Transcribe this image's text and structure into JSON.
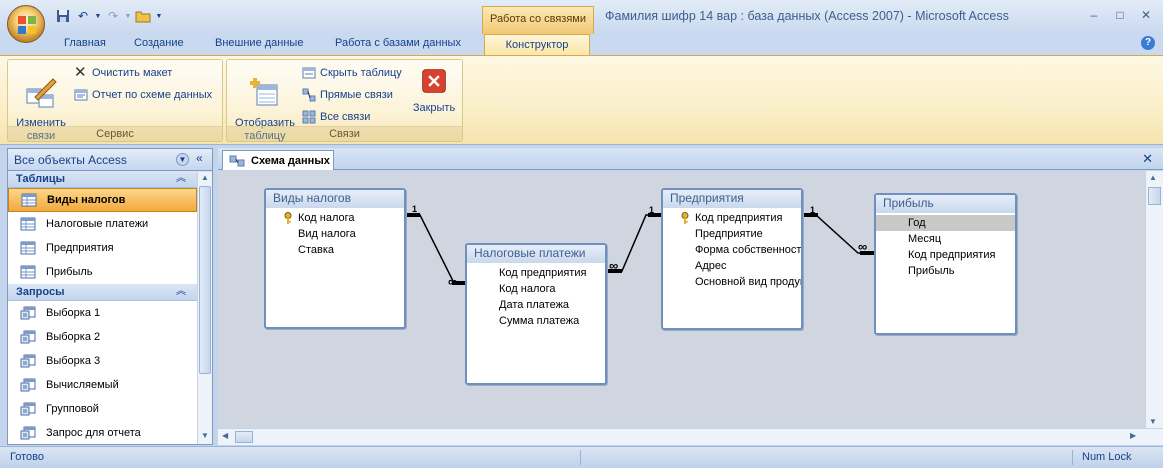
{
  "window": {
    "title": "Фамилия шифр 14 вар : база данных (Access 2007) - Microsoft Access",
    "context_tab_group": "Работа со связями",
    "controls": {
      "minimize": "–",
      "maximize": "□",
      "close": "✕"
    }
  },
  "ribbon_tabs": [
    "Главная",
    "Создание",
    "Внешние данные",
    "Работа с базами данных",
    "Конструктор"
  ],
  "active_tab": "Конструктор",
  "ribbon": {
    "service": {
      "label": "Сервис",
      "edit_relations": "Изменить\nсвязи",
      "clear_layout": "Очистить макет",
      "report": "Отчет по схеме данных"
    },
    "relations": {
      "label": "Связи",
      "show_table": "Отобразить\nтаблицу",
      "hide_table": "Скрыть таблицу",
      "direct_relations": "Прямые связи",
      "all_relations": "Все связи",
      "close": "Закрыть"
    }
  },
  "nav": {
    "title": "Все объекты Access",
    "sections": [
      {
        "label": "Таблицы",
        "items": [
          "Виды налогов",
          "Налоговые платежи",
          "Предприятия",
          "Прибыль"
        ],
        "selected": "Виды налогов"
      },
      {
        "label": "Запросы",
        "items": [
          "Выборка 1",
          "Выборка 2",
          "Выборка 3",
          "Вычисляемый",
          "Групповой",
          "Запрос для отчета"
        ]
      }
    ]
  },
  "document": {
    "tab_label": "Схема данных",
    "tables": [
      {
        "name": "Виды налогов",
        "fields": [
          "Код налога",
          "Вид налога",
          "Ставка"
        ],
        "key": "Код налога"
      },
      {
        "name": "Налоговые платежи",
        "fields": [
          "Код предприятия",
          "Код налога",
          "Дата платежа",
          "Сумма платежа"
        ]
      },
      {
        "name": "Предприятия",
        "fields": [
          "Код предприятия",
          "Предприятие",
          "Форма собственности",
          "Адрес",
          "Основной вид продукции"
        ],
        "key": "Код предприятия"
      },
      {
        "name": "Прибыль",
        "fields": [
          "Год",
          "Месяц",
          "Код предприятия",
          "Прибыль"
        ],
        "highlighted": "Год"
      }
    ],
    "relations": [
      {
        "from": "Виды налогов.Код налога",
        "to": "Налоговые платежи.Код налога",
        "one": "1",
        "many": "∞"
      },
      {
        "from": "Предприятия.Код предприятия",
        "to": "Налоговые платежи.Код предприятия",
        "one": "1",
        "many": "∞"
      },
      {
        "from": "Предприятия.Код предприятия",
        "to": "Прибыль.Код предприятия",
        "one": "1",
        "many": "∞"
      }
    ]
  },
  "status": {
    "left": "Готово",
    "right": "Num Lock"
  },
  "colors": {
    "ribbon_accent": "#f3a93c",
    "title_blue": "#15428b",
    "canvas": "#cfd6df",
    "table_border": "#6f8fbf"
  }
}
